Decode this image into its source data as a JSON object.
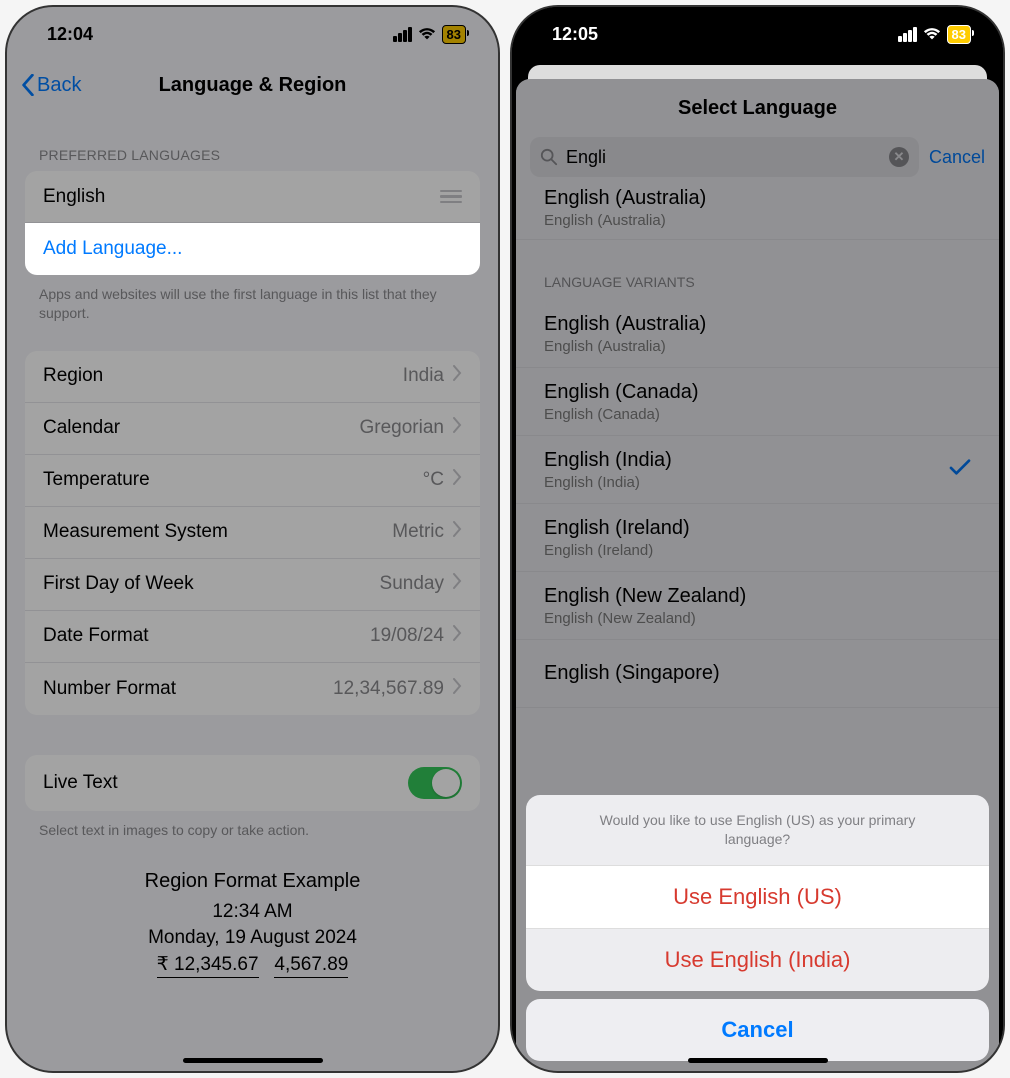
{
  "left": {
    "status": {
      "time": "12:04",
      "battery": "83"
    },
    "nav": {
      "back": "Back",
      "title": "Language & Region"
    },
    "preferred_header": "PREFERRED LANGUAGES",
    "preferred_lang": "English",
    "add_language": "Add Language...",
    "footer": "Apps and websites will use the first language in this list that they support.",
    "rows": {
      "region": {
        "label": "Region",
        "value": "India"
      },
      "calendar": {
        "label": "Calendar",
        "value": "Gregorian"
      },
      "temperature": {
        "label": "Temperature",
        "value": "°C"
      },
      "measurement": {
        "label": "Measurement System",
        "value": "Metric"
      },
      "firstday": {
        "label": "First Day of Week",
        "value": "Sunday"
      },
      "dateformat": {
        "label": "Date Format",
        "value": "19/08/24"
      },
      "numberformat": {
        "label": "Number Format",
        "value": "12,34,567.89"
      }
    },
    "livetext": {
      "label": "Live Text",
      "footer": "Select text in images to copy or take action."
    },
    "example": {
      "title": "Region Format Example",
      "time": "12:34 AM",
      "date": "Monday, 19 August 2024",
      "currency": "₹ 12,345.67",
      "number": "4,567.89"
    }
  },
  "right": {
    "status": {
      "time": "12:05",
      "battery": "83"
    },
    "sheet_title": "Select Language",
    "search": {
      "query": "Engli",
      "cancel": "Cancel"
    },
    "partial_top": {
      "primary": "English (Australia)",
      "secondary": "English (Australia)"
    },
    "variants_header": "LANGUAGE VARIANTS",
    "variants": [
      {
        "primary": "English (Australia)",
        "secondary": "English (Australia)",
        "checked": false
      },
      {
        "primary": "English (Canada)",
        "secondary": "English (Canada)",
        "checked": false
      },
      {
        "primary": "English (India)",
        "secondary": "English (India)",
        "checked": true
      },
      {
        "primary": "English (Ireland)",
        "secondary": "English (Ireland)",
        "checked": false
      },
      {
        "primary": "English (New Zealand)",
        "secondary": "English (New Zealand)",
        "checked": false
      },
      {
        "primary": "English (Singapore)",
        "secondary": "",
        "checked": false
      }
    ],
    "action": {
      "message": "Would you like to use English (US) as your primary language?",
      "opt1": "Use English (US)",
      "opt2": "Use English (India)",
      "cancel": "Cancel"
    }
  }
}
